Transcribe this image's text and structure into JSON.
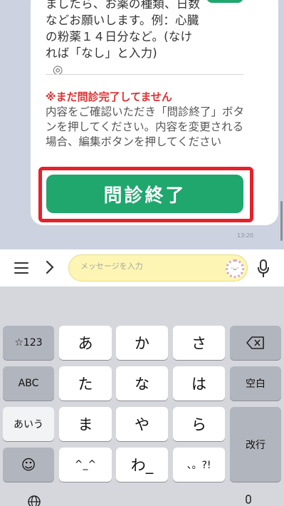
{
  "chat": {
    "message_lines": [
      "ましたら、お薬の種類、日数",
      "などお願いします。例：心臓",
      "の粉薬１４日分など。(なけ",
      "れば「なし」と入力)",
      "◎"
    ],
    "warning": "※まだ問診完了してません",
    "guide_text": "内容をご確認いただき「問診終了」ボタンを押してください。内容を変更される場合、編集ボタンを押してください",
    "finish_button_label": "問診終了",
    "timestamp": "13:20"
  },
  "input_bar": {
    "placeholder": "メッセージを入力",
    "menu_icon": "hamburger-menu-icon",
    "expand_icon": "chevron-right-icon",
    "sticker_icon": "sticker-face-icon",
    "mic_icon": "microphone-icon"
  },
  "keyboard": {
    "row1": [
      "☆123",
      "あ",
      "か",
      "さ",
      "⌫"
    ],
    "row2": [
      "ABC",
      "た",
      "な",
      "は",
      "空白"
    ],
    "row3": [
      "あいう",
      "ま",
      "や",
      "ら",
      "改行"
    ],
    "row4": [
      "☺",
      "^_^",
      "わ_",
      "、。?!"
    ]
  },
  "colors": {
    "accent_green": "#1fa76e",
    "warning_red": "#e03030",
    "highlight_frame": "#e8202a",
    "input_yellow": "#fdf5b4"
  }
}
